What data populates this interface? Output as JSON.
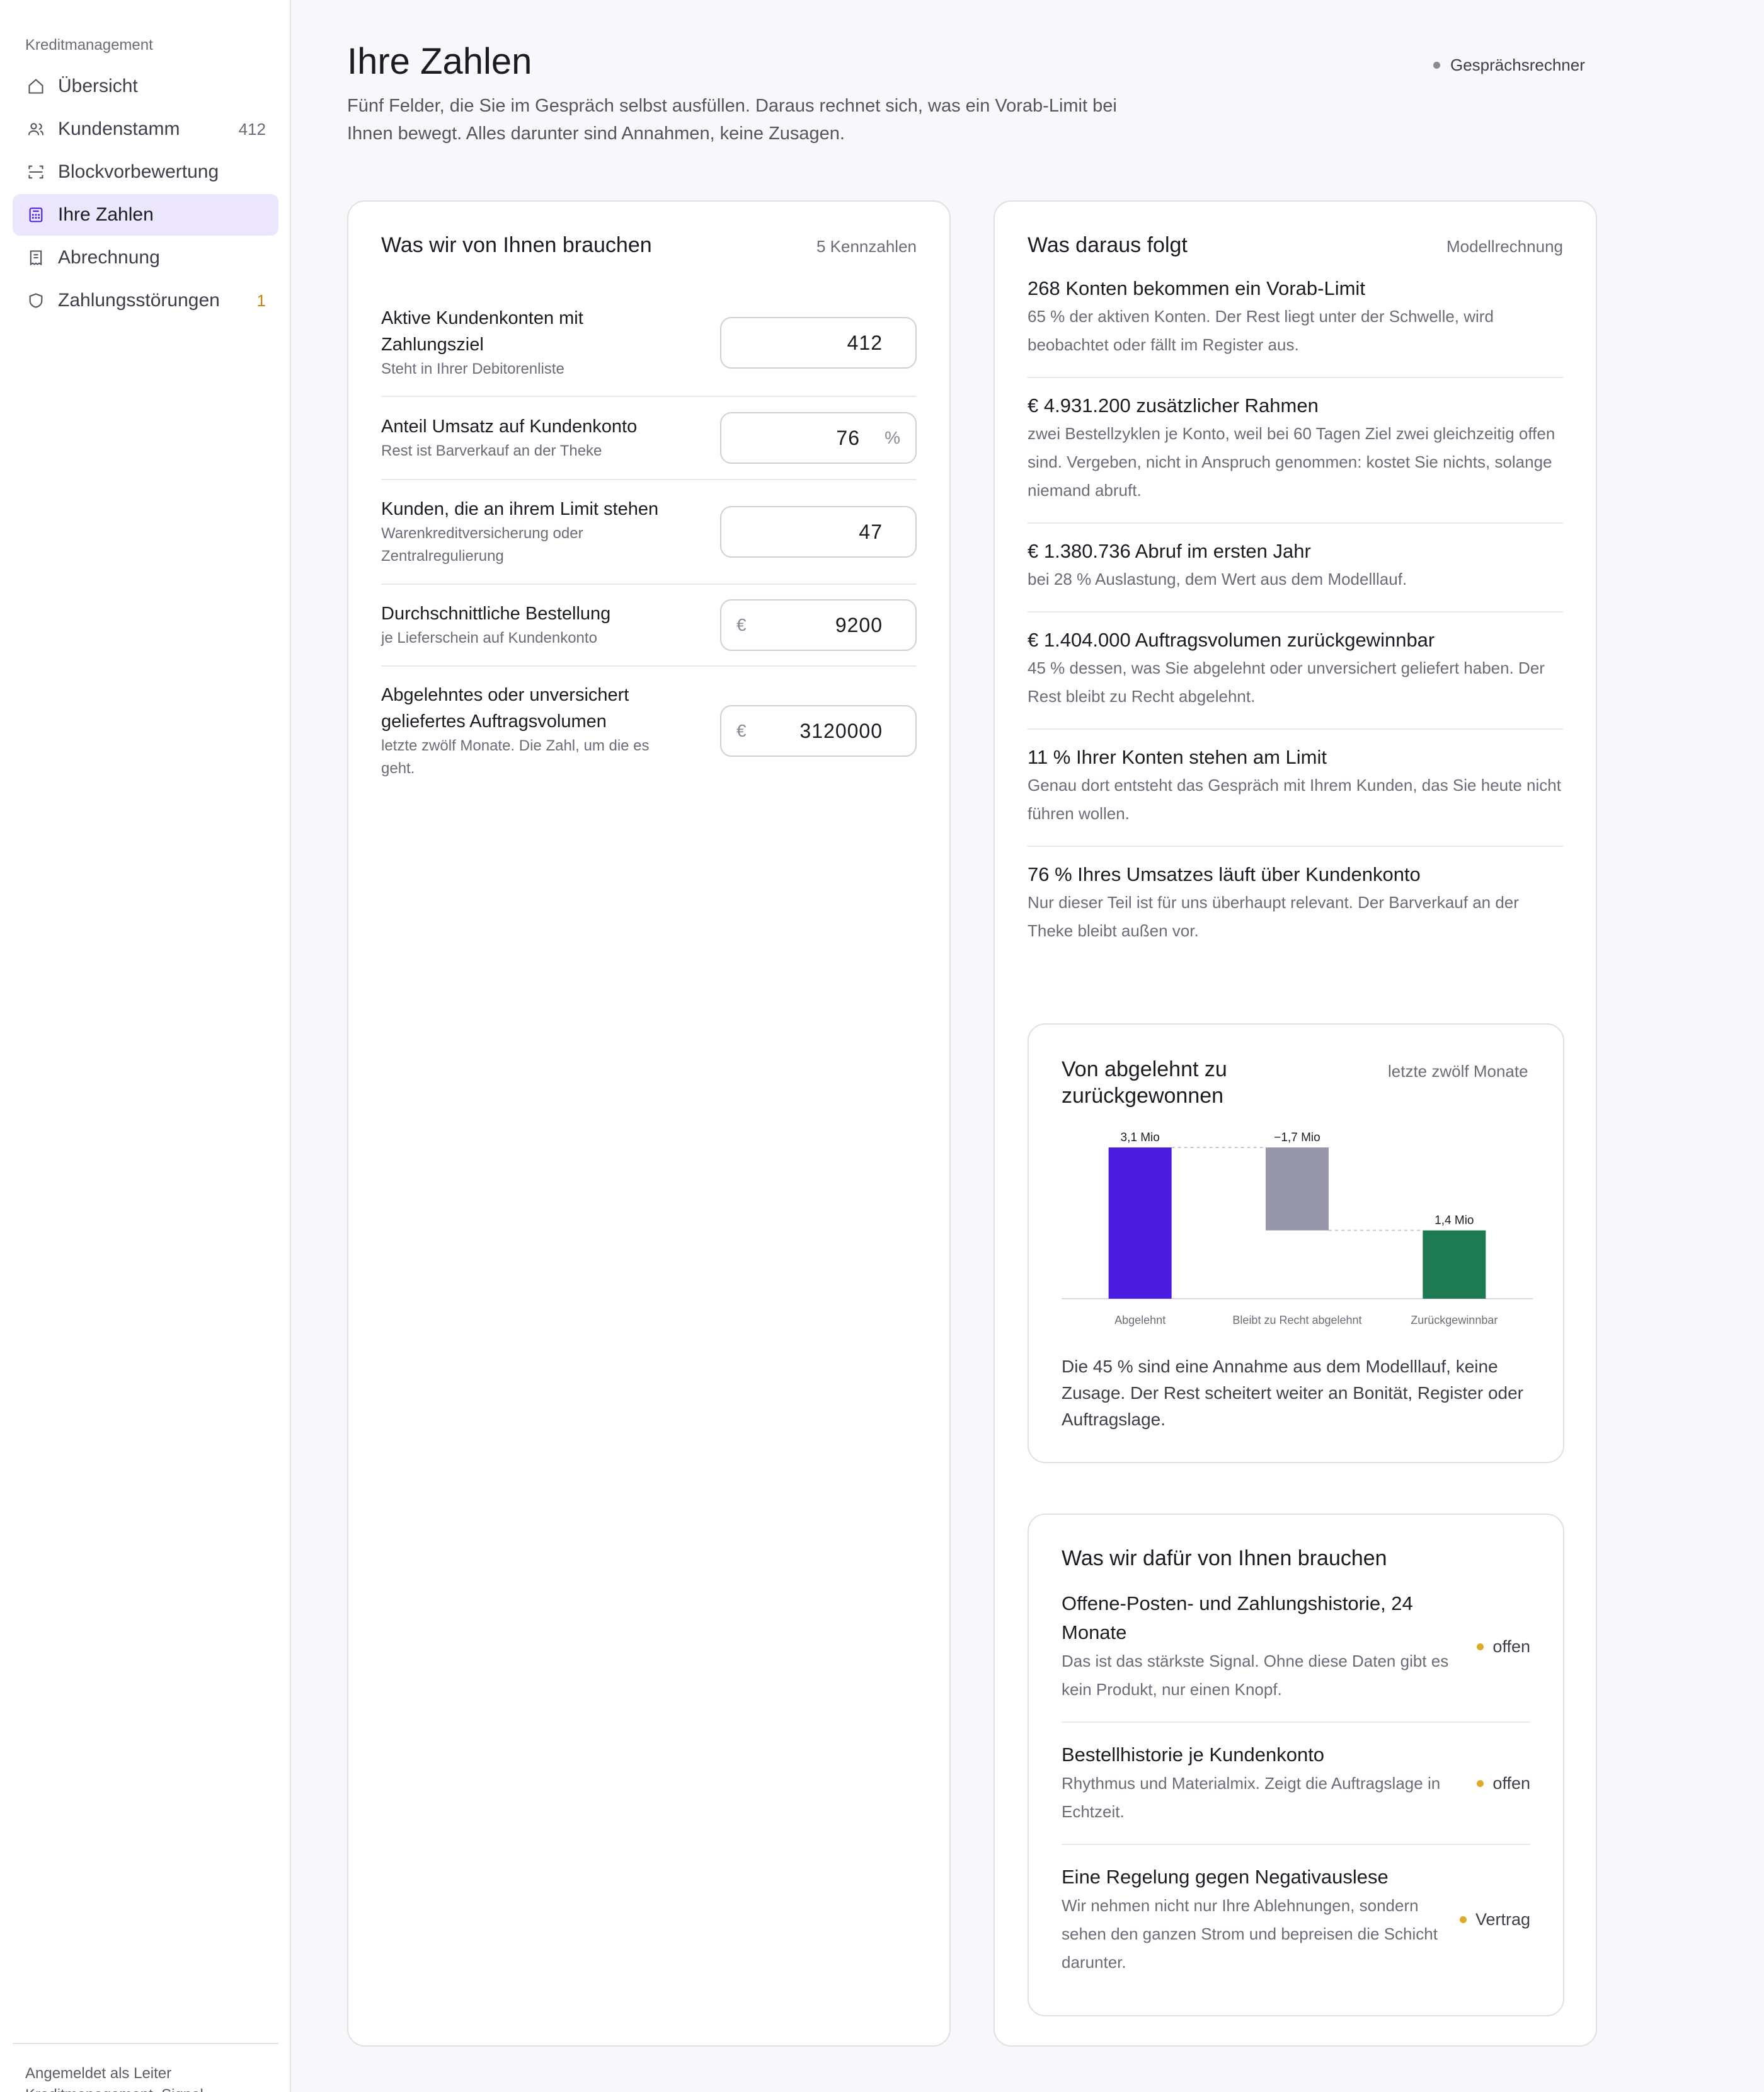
{
  "sidebar": {
    "section": "Kreditmanagement",
    "items": [
      {
        "label": "Übersicht",
        "count": ""
      },
      {
        "label": "Kundenstamm",
        "count": "412"
      },
      {
        "label": "Blockvorbewertung",
        "count": ""
      },
      {
        "label": "Ihre Zahlen",
        "count": ""
      },
      {
        "label": "Abrechnung",
        "count": ""
      },
      {
        "label": "Zahlungsstörungen",
        "count": "1"
      }
    ],
    "footer": "Angemeldet als Leiter Kreditmanagement, Signal"
  },
  "header": {
    "title": "Ihre Zahlen",
    "subtitle": "Fünf Felder, die Sie im Gespräch selbst ausfüllen. Daraus rechnet sich, was ein Vorab-Limit bei Ihnen bewegt. Alles darunter sind Annahmen, keine Zusagen.",
    "badge": "Gesprächsrechner"
  },
  "inputs_card": {
    "title": "Was wir von Ihnen brauchen",
    "meta": "5 Kennzahlen",
    "fields": [
      {
        "label": "Aktive Kundenkonten mit Zahlungsziel",
        "hint": "Steht in Ihrer Debitorenliste",
        "value": "412",
        "prefix": "",
        "suffix": ""
      },
      {
        "label": "Anteil Umsatz auf Kundenkonto",
        "hint": "Rest ist Barverkauf an der Theke",
        "value": "76",
        "prefix": "",
        "suffix": "%"
      },
      {
        "label": "Kunden, die an ihrem Limit stehen",
        "hint": "Warenkreditversicherung oder Zentralregulierung",
        "value": "47",
        "prefix": "",
        "suffix": ""
      },
      {
        "label": "Durchschnittliche Bestellung",
        "hint": "je Lieferschein auf Kundenkonto",
        "value": "9200",
        "prefix": "€",
        "suffix": ""
      },
      {
        "label": "Abgelehntes oder unversichert geliefertes Auftragsvolumen",
        "hint": "letzte zwölf Monate. Die Zahl, um die es geht.",
        "value": "3120000",
        "prefix": "€",
        "suffix": ""
      }
    ]
  },
  "results_card": {
    "title": "Was daraus folgt",
    "meta": "Modellrechnung",
    "items": [
      {
        "title": "268 Konten bekommen ein Vorab-Limit",
        "desc": "65 % der aktiven Konten. Der Rest liegt unter der Schwelle, wird beobachtet oder fällt im Register aus."
      },
      {
        "title": "€ 4.931.200 zusätzlicher Rahmen",
        "desc": "zwei Bestellzyklen je Konto, weil bei 60 Tagen Ziel zwei gleichzeitig offen sind. Vergeben, nicht in Anspruch genommen: kostet Sie nichts, solange niemand abruft."
      },
      {
        "title": "€ 1.380.736 Abruf im ersten Jahr",
        "desc": "bei 28 % Auslastung, dem Wert aus dem Modelllauf."
      },
      {
        "title": "€ 1.404.000 Auftragsvolumen zurückgewinnbar",
        "desc": "45 % dessen, was Sie abgelehnt oder unversichert geliefert haben. Der Rest bleibt zu Recht abgelehnt."
      },
      {
        "title": "11 % Ihrer Konten stehen am Limit",
        "desc": "Genau dort entsteht das Gespräch mit Ihrem Kunden, das Sie heute nicht führen wollen."
      },
      {
        "title": "76 % Ihres Umsatzes läuft über Kundenkonto",
        "desc": "Nur dieser Teil ist für uns überhaupt relevant. Der Barverkauf an der Theke bleibt außen vor."
      }
    ],
    "chart_card": {
      "title": "Von abgelehnt zu zurückgewonnen",
      "meta": "letzte zwölf Monate",
      "note": "Die 45 % sind eine Annahme aus dem Modelllauf, keine Zusage. Der Rest scheitert weiter an Bonität, Register oder Auftragslage."
    },
    "needs_card": {
      "title": "Was wir dafür von Ihnen brauchen",
      "items": [
        {
          "title": "Offene-Posten- und Zahlungshistorie, 24 Monate",
          "desc": "Das ist das stärkste Signal. Ohne diese Daten gibt es kein Produkt, nur einen Knopf.",
          "status": "offen"
        },
        {
          "title": "Bestellhistorie je Kundenkonto",
          "desc": "Rhythmus und Materialmix. Zeigt die Auftragslage in Echtzeit.",
          "status": "offen"
        },
        {
          "title": "Eine Regelung gegen Negativauslese",
          "desc": "Wir nehmen nicht nur Ihre Ablehnungen, sondern sehen den ganzen Strom und bepreisen die Schicht darunter.",
          "status": "Vertrag"
        }
      ]
    }
  },
  "chart_data": {
    "type": "bar",
    "subtype": "waterfall",
    "categories": [
      "Abgelehnt",
      "Bleibt zu Recht abgelehnt",
      "Zurückgewinnbar"
    ],
    "values": [
      3.1,
      -1.7,
      1.4
    ],
    "data_labels": [
      "3,1 Mio",
      "−1,7 Mio",
      "1,4 Mio"
    ],
    "colors": [
      "#4a1ce0",
      "#9796aa",
      "#1e7a52"
    ],
    "ylim": [
      0,
      3.1
    ],
    "title": "Von abgelehnt zu zurückgewonnen",
    "xlabel": "",
    "ylabel": ""
  },
  "colors": {
    "accent": "#4a1ce0",
    "active_bg": "#ebe6fd",
    "warn": "#c78316",
    "status_dot": "#e0a92a",
    "green": "#1e7a52"
  }
}
